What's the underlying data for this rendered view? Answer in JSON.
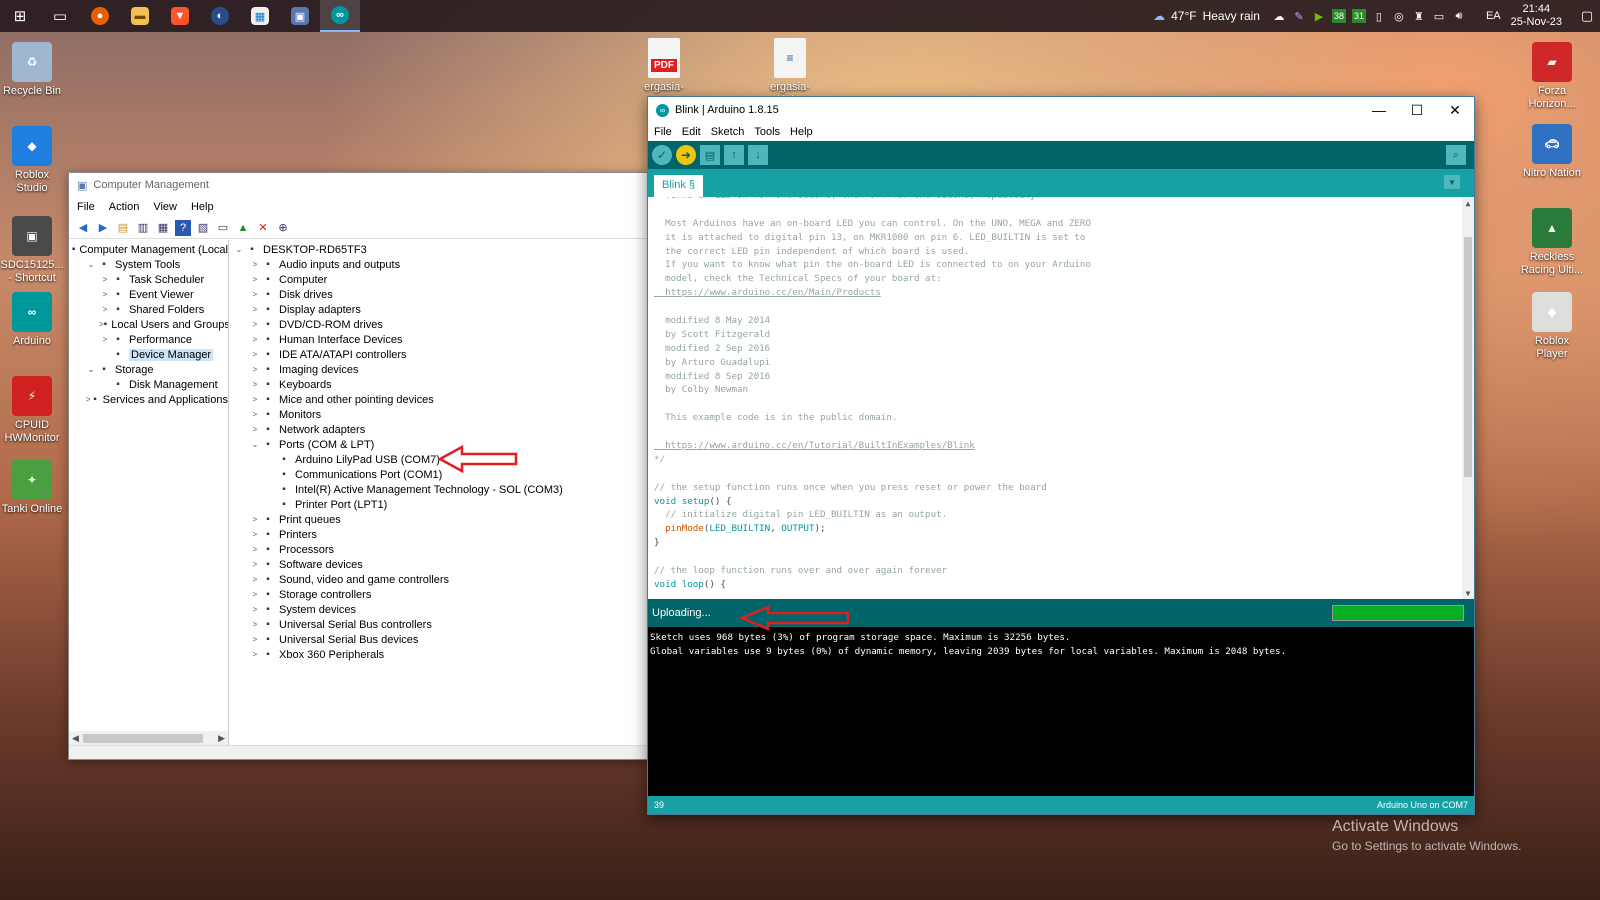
{
  "taskbar": {
    "weather": {
      "temp": "47°F",
      "condition": "Heavy rain"
    },
    "tray_badges": [
      "38",
      "31"
    ],
    "language": "EA",
    "time": "21:44",
    "date": "25-Nov-23"
  },
  "desktop_icons_left": [
    {
      "label": "Recycle Bin",
      "icon": "recycle-bin-icon",
      "color": "#9fb7d0"
    },
    {
      "label": "Roblox Studio",
      "icon": "roblox-studio-icon",
      "color": "#1e7fe0"
    },
    {
      "label": "SDC15125... - Shortcut",
      "icon": "image-shortcut-icon",
      "color": "#4a4a4a"
    },
    {
      "label": "Arduino",
      "icon": "arduino-icon",
      "color": "#00979c"
    },
    {
      "label": "CPUID HWMonitor",
      "icon": "hwmonitor-icon",
      "color": "#d02020"
    },
    {
      "label": "Tanki Online",
      "icon": "tanki-icon",
      "color": "#4aa040"
    }
  ],
  "desktop_icons_top": [
    {
      "label": "ergasia-mo...",
      "icon": "pdf-file-icon",
      "badge": "PDF"
    },
    {
      "label": "ergasia-kini...",
      "icon": "document-file-icon",
      "badge": ""
    }
  ],
  "desktop_icons_right": [
    {
      "label": "Forza Horizon...",
      "icon": "forza-icon",
      "color": "#d02828"
    },
    {
      "label": "Nitro Nation",
      "icon": "nitro-nation-icon",
      "color": "#3070c0"
    },
    {
      "label": "Reckless Racing Ulti...",
      "icon": "reckless-racing-icon",
      "color": "#2a7a3a"
    },
    {
      "label": "Roblox Player",
      "icon": "roblox-player-icon",
      "color": "#dddddd"
    }
  ],
  "computer_management": {
    "title": "Computer Management",
    "menu": [
      "File",
      "Action",
      "View",
      "Help"
    ],
    "left_tree": [
      {
        "label": "Computer Management (Local",
        "level": 0,
        "arrow": "",
        "icon": "computer-management-icon"
      },
      {
        "label": "System Tools",
        "level": 1,
        "arrow": "⌄",
        "icon": "tools-icon"
      },
      {
        "label": "Task Scheduler",
        "level": 2,
        "arrow": ">",
        "icon": "clock-icon"
      },
      {
        "label": "Event Viewer",
        "level": 2,
        "arrow": ">",
        "icon": "event-viewer-icon"
      },
      {
        "label": "Shared Folders",
        "level": 2,
        "arrow": ">",
        "icon": "folder-icon"
      },
      {
        "label": "Local Users and Groups",
        "level": 2,
        "arrow": ">",
        "icon": "users-icon"
      },
      {
        "label": "Performance",
        "level": 2,
        "arrow": ">",
        "icon": "performance-icon"
      },
      {
        "label": "Device Manager",
        "level": 2,
        "arrow": "",
        "icon": "device-manager-icon",
        "selected": true
      },
      {
        "label": "Storage",
        "level": 1,
        "arrow": "⌄",
        "icon": "storage-icon"
      },
      {
        "label": "Disk Management",
        "level": 2,
        "arrow": "",
        "icon": "disk-icon"
      },
      {
        "label": "Services and Applications",
        "level": 1,
        "arrow": ">",
        "icon": "services-icon"
      }
    ],
    "device_tree": [
      {
        "label": "DESKTOP-RD65TF3",
        "level": 0,
        "arrow": "⌄",
        "icon": "computer-icon"
      },
      {
        "label": "Audio inputs and outputs",
        "level": 1,
        "arrow": ">",
        "icon": "speaker-icon"
      },
      {
        "label": "Computer",
        "level": 1,
        "arrow": ">",
        "icon": "monitor-icon"
      },
      {
        "label": "Disk drives",
        "level": 1,
        "arrow": ">",
        "icon": "disk-drive-icon"
      },
      {
        "label": "Display adapters",
        "level": 1,
        "arrow": ">",
        "icon": "display-adapter-icon"
      },
      {
        "label": "DVD/CD-ROM drives",
        "level": 1,
        "arrow": ">",
        "icon": "dvd-icon"
      },
      {
        "label": "Human Interface Devices",
        "level": 1,
        "arrow": ">",
        "icon": "hid-icon"
      },
      {
        "label": "IDE ATA/ATAPI controllers",
        "level": 1,
        "arrow": ">",
        "icon": "ide-icon"
      },
      {
        "label": "Imaging devices",
        "level": 1,
        "arrow": ">",
        "icon": "camera-icon"
      },
      {
        "label": "Keyboards",
        "level": 1,
        "arrow": ">",
        "icon": "keyboard-icon"
      },
      {
        "label": "Mice and other pointing devices",
        "level": 1,
        "arrow": ">",
        "icon": "mouse-icon"
      },
      {
        "label": "Monitors",
        "level": 1,
        "arrow": ">",
        "icon": "monitor-icon"
      },
      {
        "label": "Network adapters",
        "level": 1,
        "arrow": ">",
        "icon": "network-icon"
      },
      {
        "label": "Ports (COM & LPT)",
        "level": 1,
        "arrow": "⌄",
        "icon": "port-icon"
      },
      {
        "label": "Arduino LilyPad USB (COM7)",
        "level": 2,
        "arrow": "",
        "icon": "port-icon"
      },
      {
        "label": "Communications Port (COM1)",
        "level": 2,
        "arrow": "",
        "icon": "port-icon"
      },
      {
        "label": "Intel(R) Active Management Technology - SOL (COM3)",
        "level": 2,
        "arrow": "",
        "icon": "port-icon"
      },
      {
        "label": "Printer Port (LPT1)",
        "level": 2,
        "arrow": "",
        "icon": "port-icon"
      },
      {
        "label": "Print queues",
        "level": 1,
        "arrow": ">",
        "icon": "printer-icon"
      },
      {
        "label": "Printers",
        "level": 1,
        "arrow": ">",
        "icon": "printer-icon"
      },
      {
        "label": "Processors",
        "level": 1,
        "arrow": ">",
        "icon": "cpu-icon"
      },
      {
        "label": "Software devices",
        "level": 1,
        "arrow": ">",
        "icon": "software-device-icon"
      },
      {
        "label": "Sound, video and game controllers",
        "level": 1,
        "arrow": ">",
        "icon": "speaker-icon"
      },
      {
        "label": "Storage controllers",
        "level": 1,
        "arrow": ">",
        "icon": "storage-controller-icon"
      },
      {
        "label": "System devices",
        "level": 1,
        "arrow": ">",
        "icon": "system-device-icon"
      },
      {
        "label": "Universal Serial Bus controllers",
        "level": 1,
        "arrow": ">",
        "icon": "usb-icon"
      },
      {
        "label": "Universal Serial Bus devices",
        "level": 1,
        "arrow": ">",
        "icon": "usb-icon"
      },
      {
        "label": "Xbox 360 Peripherals",
        "level": 1,
        "arrow": ">",
        "icon": "gamepad-icon"
      }
    ]
  },
  "arduino": {
    "title": "Blink | Arduino 1.8.15",
    "menu": [
      "File",
      "Edit",
      "Sketch",
      "Tools",
      "Help"
    ],
    "tab": "Blink §",
    "code": [
      {
        "t": "  Turns an LED on for one second, then off for one second, repeatedly.",
        "c": "c-comment"
      },
      {
        "t": "",
        "c": "c-comment"
      },
      {
        "t": "  Most Arduinos have an on-board LED you can control. On the UNO, MEGA and ZERO",
        "c": "c-comment"
      },
      {
        "t": "  it is attached to digital pin 13, on MKR1000 on pin 6. LED_BUILTIN is set to",
        "c": "c-comment"
      },
      {
        "t": "  the correct LED pin independent of which board is used.",
        "c": "c-comment"
      },
      {
        "t": "  If you want to know what pin the on-board LED is connected to on your Arduino",
        "c": "c-comment"
      },
      {
        "t": "  model, check the Technical Specs of your board at:",
        "c": "c-comment"
      },
      {
        "t": "  https://www.arduino.cc/en/Main/Products",
        "c": "c-link"
      },
      {
        "t": "",
        "c": "c-comment"
      },
      {
        "t": "  modified 8 May 2014",
        "c": "c-comment"
      },
      {
        "t": "  by Scott Fitzgerald",
        "c": "c-comment"
      },
      {
        "t": "  modified 2 Sep 2016",
        "c": "c-comment"
      },
      {
        "t": "  by Arturo Guadalupi",
        "c": "c-comment"
      },
      {
        "t": "  modified 8 Sep 2016",
        "c": "c-comment"
      },
      {
        "t": "  by Colby Newman",
        "c": "c-comment"
      },
      {
        "t": "",
        "c": "c-comment"
      },
      {
        "t": "  This example code is in the public domain.",
        "c": "c-comment"
      },
      {
        "t": "",
        "c": "c-comment"
      },
      {
        "t": "  https://www.arduino.cc/en/Tutorial/BuiltInExamples/Blink",
        "c": "c-link"
      },
      {
        "t": "*/",
        "c": "c-comment"
      },
      {
        "t": "",
        "c": "c-comment"
      },
      {
        "t": "// the setup function runs once when you press reset or power the board",
        "c": "c-comment"
      },
      {
        "t": "void setup() {",
        "c": "mixed-setup"
      },
      {
        "t": "  // initialize digital pin LED_BUILTIN as an output.",
        "c": "c-comment"
      },
      {
        "t": "  pinMode(LED_BUILTIN, OUTPUT);",
        "c": "mixed-pinmode"
      },
      {
        "t": "}",
        "c": "c-plain"
      },
      {
        "t": "",
        "c": "c-comment"
      },
      {
        "t": "// the loop function runs over and over again forever",
        "c": "c-comment"
      },
      {
        "t": "void loop() {",
        "c": "mixed-loop"
      }
    ],
    "status": "Uploading...",
    "progress": 1.0,
    "console": [
      "Sketch uses 968 bytes (3%) of program storage space. Maximum is 32256 bytes.",
      "Global variables use 9 bytes (0%) of dynamic memory, leaving 2039 bytes for local variables. Maximum is 2048 bytes."
    ],
    "line_number": "39",
    "board": "Arduino Uno on COM7"
  },
  "watermark": {
    "title": "Activate Windows",
    "subtitle": "Go to Settings to activate Windows."
  },
  "colors": {
    "arduino_dark": "#006468",
    "arduino_teal": "#17a1a5",
    "progress_green": "#06b025",
    "annotation_red": "#e02020"
  }
}
